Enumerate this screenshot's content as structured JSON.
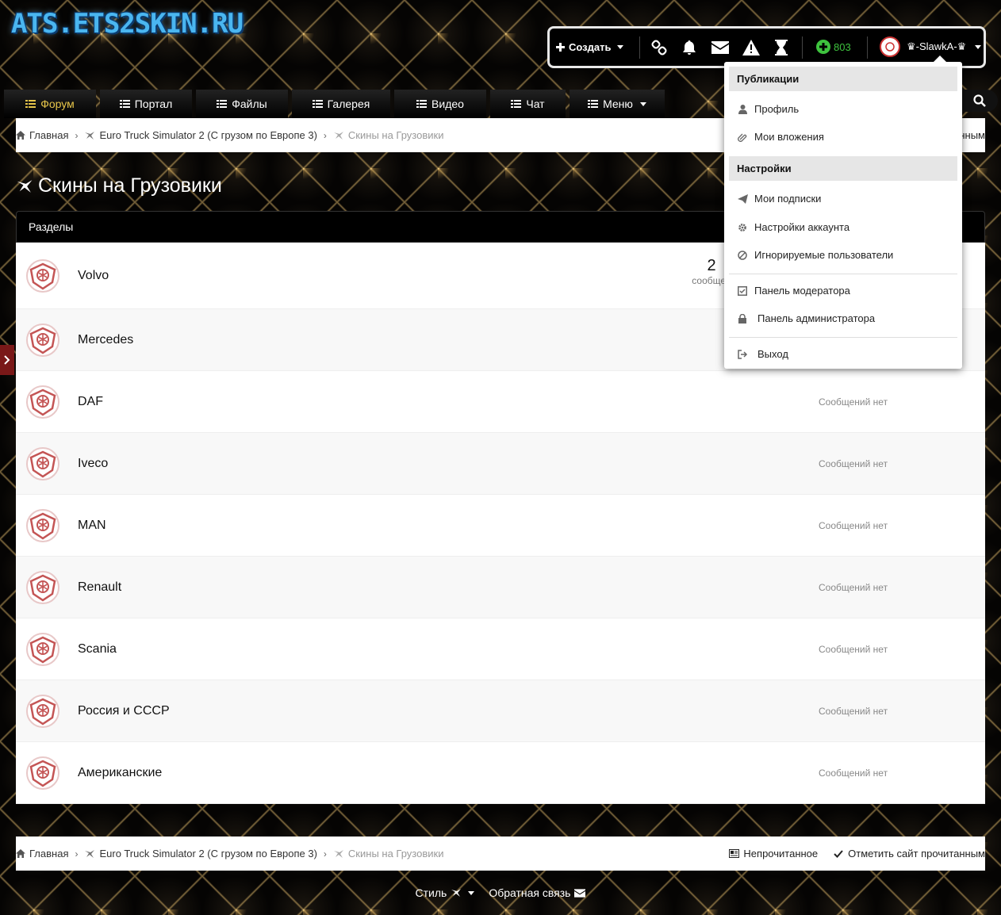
{
  "site": {
    "logo": "ATS.ETS2SKIN.RU"
  },
  "userbar": {
    "create_label": "Создать",
    "points": "803",
    "username": "♛-SlawkA-♛",
    "icons": [
      "links-icon",
      "bell-icon",
      "envelope-icon",
      "warning-icon",
      "hourglass-icon"
    ]
  },
  "nav": {
    "tabs": [
      {
        "label": "Форум",
        "active": true
      },
      {
        "label": "Портал"
      },
      {
        "label": "Файлы"
      },
      {
        "label": "Галерея"
      },
      {
        "label": "Видео"
      },
      {
        "label": "Чат"
      },
      {
        "label": "Меню"
      }
    ]
  },
  "breadcrumb": {
    "home": "Главная",
    "category": "Euro Truck Simulator 2 (С грузом по Европе 3)",
    "current": "Скины на Грузовики",
    "top_right_partial": "нным"
  },
  "page": {
    "title": "Скины на Грузовики"
  },
  "forums": {
    "header": "Разделы",
    "rows": [
      {
        "title": "Volvo",
        "count": "2",
        "count_label": "сообщен"
      },
      {
        "title": "Mercedes"
      },
      {
        "title": "DAF",
        "status": "Сообщений нет"
      },
      {
        "title": "Iveco",
        "status": "Сообщений нет"
      },
      {
        "title": "MAN",
        "status": "Сообщений нет"
      },
      {
        "title": "Renault",
        "status": "Сообщений нет"
      },
      {
        "title": "Scania",
        "status": "Сообщений нет"
      },
      {
        "title": "Россия и СССР",
        "status": "Сообщений нет"
      },
      {
        "title": "Американские",
        "status": "Сообщений нет"
      }
    ]
  },
  "user_menu": {
    "section_publications": "Публикации",
    "profile": "Профиль",
    "attachments": "Мои вложения",
    "section_settings": "Настройки",
    "subscriptions": "Мои подписки",
    "account_settings": "Настройки аккаунта",
    "ignored_users": "Игнорируемые пользователи",
    "moderator_panel": "Панель модератора",
    "admin_panel": "Панель администратора",
    "logout": "Выход"
  },
  "bottom_bar": {
    "unread": "Непрочитанное",
    "mark_read": "Отметить сайт прочитанным"
  },
  "footer": {
    "style": "Стиль",
    "feedback": "Обратная связь"
  },
  "colors": {
    "accent": "#e6c54a",
    "points": "#3ec33e",
    "logo": "#4ab6f0"
  }
}
